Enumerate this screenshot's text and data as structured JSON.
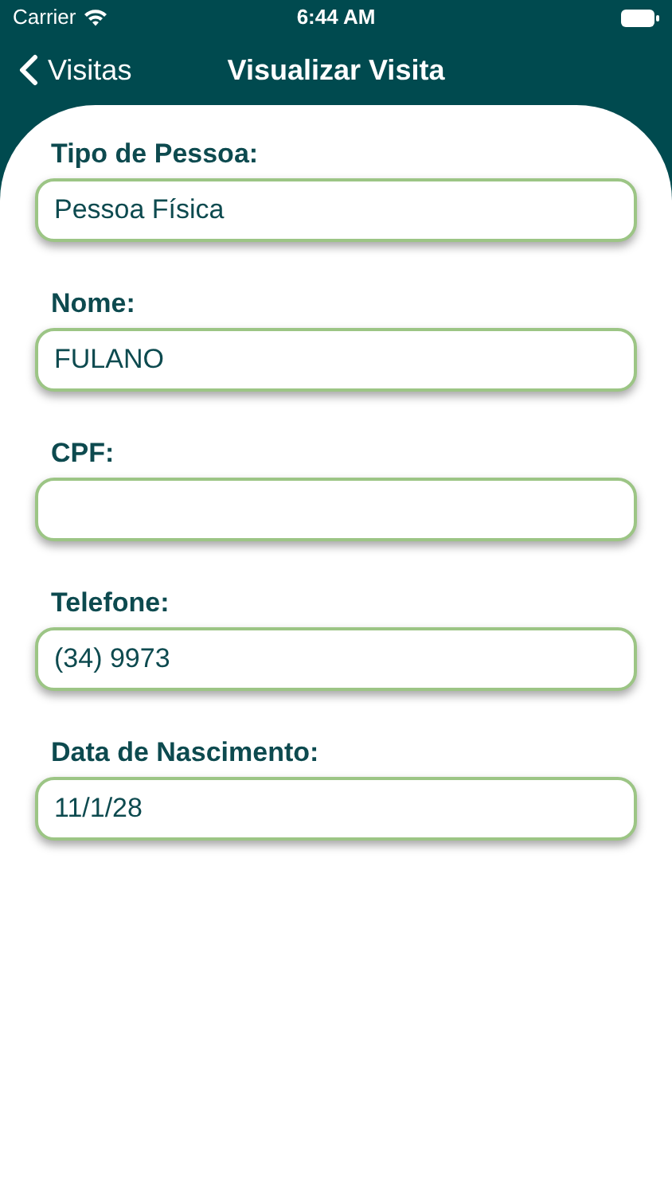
{
  "status_bar": {
    "carrier": "Carrier",
    "time": "6:44 AM"
  },
  "nav": {
    "back_label": "Visitas",
    "title": "Visualizar Visita"
  },
  "fields": [
    {
      "label": "Tipo de Pessoa:",
      "value": "Pessoa Física"
    },
    {
      "label": "Nome:",
      "value": "FULANO"
    },
    {
      "label": "CPF:"
    },
    {
      "label": "Telefone:",
      "value": "(34) 9973"
    },
    {
      "label": "Data de Nascimento:",
      "value": "11/1/28"
    }
  ]
}
